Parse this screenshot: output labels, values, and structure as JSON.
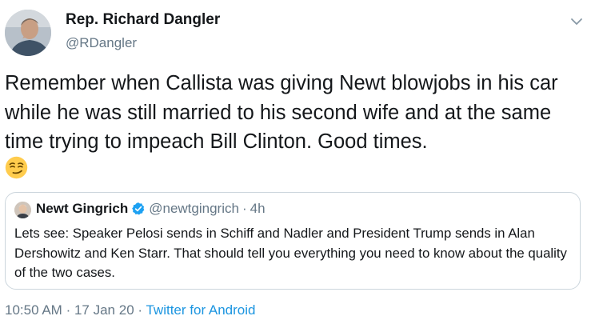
{
  "tweet": {
    "author": {
      "name": "Rep. Richard Dangler",
      "handle": "@RDangler"
    },
    "text": "Remember when Callista was giving Newt blowjobs in his car while he was still married to his second wife and at the same time trying to impeach Bill Clinton. Good times.",
    "emoji": "smirking-face",
    "quoted": {
      "name": "Newt Gingrich",
      "handle": "@newtgingrich",
      "separator": "·",
      "time": "4h",
      "text": "Lets see: Speaker Pelosi sends in Schiff and Nadler and President Trump sends in Alan Dershowitz and Ken Starr. That should tell you everything you need to know about the quality of the two cases."
    },
    "meta": {
      "time": "10:50 AM",
      "sep1": "·",
      "date": "17 Jan 20",
      "sep2": "·",
      "source": "Twitter for Android"
    }
  },
  "colors": {
    "text": "#14171a",
    "secondary": "#657786",
    "link": "#1b95e0",
    "border": "#ccd6dd",
    "verified": "#1da1f2",
    "emoji_face": "#ffcc4d"
  }
}
